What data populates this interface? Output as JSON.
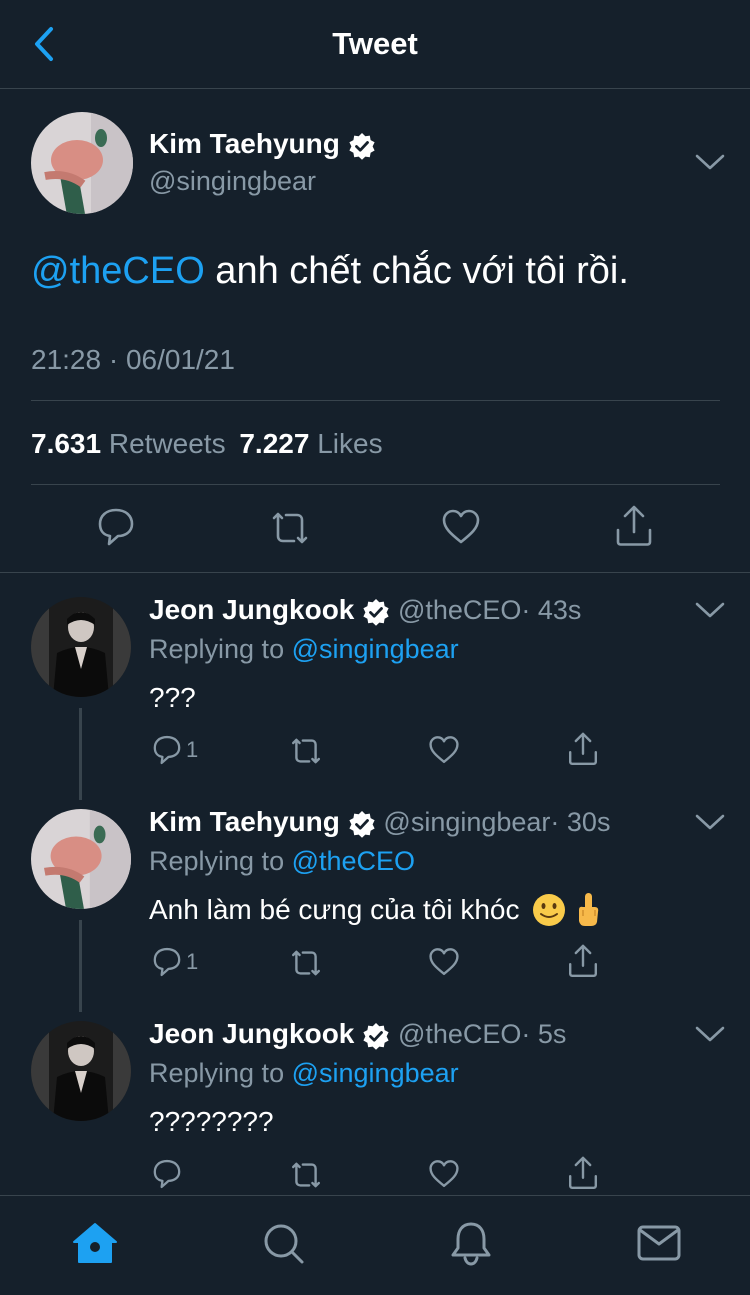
{
  "header": {
    "title": "Tweet"
  },
  "main_tweet": {
    "name": "Kim Taehyung",
    "handle": "@singingbear",
    "mention": "@theCEO",
    "text": " anh chết chắc với tôi rồi.",
    "time": "21:28 · 06/01/21",
    "retweets_count": "7.631",
    "retweets_label": "Retweets",
    "likes_count": "7.227",
    "likes_label": "Likes"
  },
  "replies": [
    {
      "name": "Jeon Jungkook",
      "handle": "@theCEO",
      "time": "· 43s",
      "replying_label": "Replying to",
      "replying_to": "@singingbear",
      "text": "???",
      "reply_count": "1"
    },
    {
      "name": "Kim Taehyung",
      "handle": "@singingbear",
      "time": "· 30s",
      "replying_label": "Replying to",
      "replying_to": "@theCEO",
      "text": "Anh làm bé cưng của tôi khóc ",
      "reply_count": "1"
    },
    {
      "name": "Jeon Jungkook",
      "handle": "@theCEO",
      "time": "· 5s",
      "replying_label": "Replying to",
      "replying_to": "@singingbear",
      "text": "????????",
      "reply_count": ""
    }
  ],
  "tabbar": {
    "icons": [
      "home-icon",
      "search-icon",
      "bell-icon",
      "mail-icon"
    ]
  },
  "colors": {
    "background": "#15202b",
    "accent": "#1da1f2",
    "muted": "#8899a6",
    "divider": "#38444d"
  }
}
